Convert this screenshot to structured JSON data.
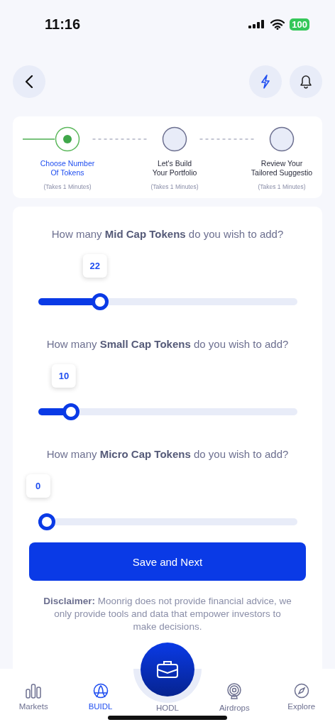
{
  "status_bar": {
    "time": "11:16",
    "battery": "100"
  },
  "stepper": [
    {
      "label_lines": [
        "Choose Number",
        "Of Tokens"
      ],
      "duration": "(Takes 1 Minutes)",
      "current": true
    },
    {
      "label_lines": [
        "Let's Build",
        "Your Portfolio"
      ],
      "duration": "(Takes 1 Minutes)",
      "current": false
    },
    {
      "label_lines": [
        "Review Your",
        "Tailored Suggestio"
      ],
      "duration": "(Takes 1 Minutes)",
      "current": false
    }
  ],
  "questions": [
    {
      "text": "How many **Mid Cap Tokens** do you wish to add?",
      "value": "22",
      "level": 0.22
    },
    {
      "text": "How many **Small Cap Tokens** do you wish to add?",
      "value": "10",
      "level": 0.1
    },
    {
      "text": "How many **Micro Cap Tokens** do you wish to add?",
      "value": "0",
      "level": 0
    }
  ],
  "save_button": "Save and Next",
  "disclaimer": "**Disclaimer:** Moonrig does not provide financial advice, we only provide tools and data that empower investors to make decisions.",
  "tabs": [
    {
      "label": "Markets",
      "kind": "bars",
      "selected": false
    },
    {
      "label": "BUIDL",
      "kind": "globe",
      "selected": true
    },
    {
      "label": "HODL",
      "kind": "fab",
      "selected": false
    },
    {
      "label": "Airdrops",
      "kind": "signal",
      "selected": false
    },
    {
      "label": "Explore",
      "kind": "compass",
      "selected": false
    }
  ]
}
